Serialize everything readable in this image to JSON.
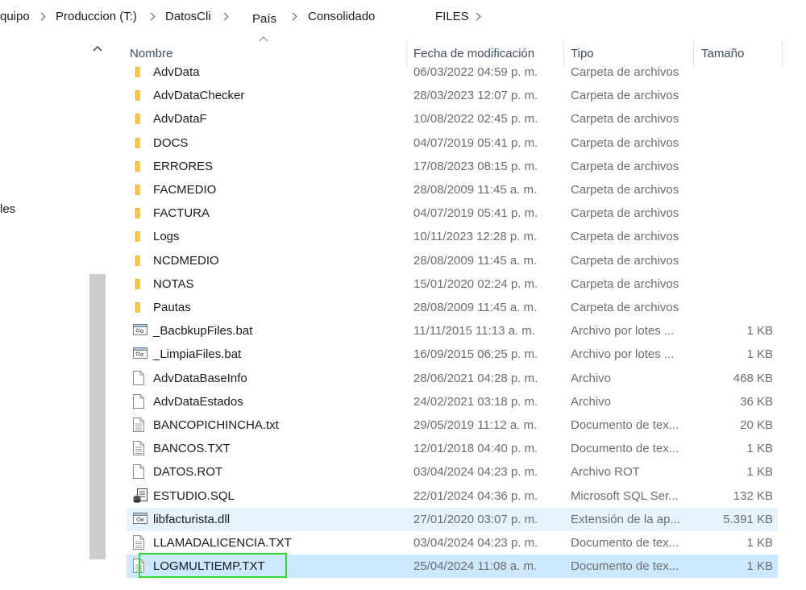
{
  "breadcrumb": [
    {
      "label": "quipo"
    },
    {
      "label": "Produccion (T:)"
    },
    {
      "label": "DatosCli"
    },
    {
      "label": "País"
    },
    {
      "label": "Consolidado"
    },
    {
      "label": "FILES"
    }
  ],
  "nav_fragment": "les",
  "columns": {
    "name": "Nombre",
    "date": "Fecha de modificación",
    "type": "Tipo",
    "size": "Tamaño"
  },
  "files": [
    {
      "name": "AdvData",
      "date": "06/03/2022 04:59 p. m.",
      "type": "Carpeta de archivos",
      "size": "",
      "icon": "folder-icon"
    },
    {
      "name": "AdvDataChecker",
      "date": "28/03/2023 12:07 p. m.",
      "type": "Carpeta de archivos",
      "size": "",
      "icon": "folder-icon"
    },
    {
      "name": "AdvDataF",
      "date": "10/08/2022 02:45 p. m.",
      "type": "Carpeta de archivos",
      "size": "",
      "icon": "folder-icon"
    },
    {
      "name": "DOCS",
      "date": "04/07/2019 05:41 p. m.",
      "type": "Carpeta de archivos",
      "size": "",
      "icon": "folder-icon"
    },
    {
      "name": "ERRORES",
      "date": "17/08/2023 08:15 p. m.",
      "type": "Carpeta de archivos",
      "size": "",
      "icon": "folder-icon"
    },
    {
      "name": "FACMEDIO",
      "date": "28/08/2009 11:45 a. m.",
      "type": "Carpeta de archivos",
      "size": "",
      "icon": "folder-icon"
    },
    {
      "name": "FACTURA",
      "date": "04/07/2019 05:41 p. m.",
      "type": "Carpeta de archivos",
      "size": "",
      "icon": "folder-icon"
    },
    {
      "name": "Logs",
      "date": "10/11/2023 12:28 p. m.",
      "type": "Carpeta de archivos",
      "size": "",
      "icon": "folder-icon"
    },
    {
      "name": "NCDMEDIO",
      "date": "28/08/2009 11:45 a. m.",
      "type": "Carpeta de archivos",
      "size": "",
      "icon": "folder-icon"
    },
    {
      "name": "NOTAS",
      "date": "15/01/2020 02:24 p. m.",
      "type": "Carpeta de archivos",
      "size": "",
      "icon": "folder-icon"
    },
    {
      "name": "Pautas",
      "date": "28/08/2009 11:45 a. m.",
      "type": "Carpeta de archivos",
      "size": "",
      "icon": "folder-icon"
    },
    {
      "name": "_BacbkupFiles.bat",
      "date": "11/11/2015 11:13 a. m.",
      "type": "Archivo por lotes ...",
      "size": "1 KB",
      "icon": "batch-file-icon"
    },
    {
      "name": "_LimpiaFiles.bat",
      "date": "16/09/2015 06:25 p. m.",
      "type": "Archivo por lotes ...",
      "size": "1 KB",
      "icon": "batch-file-icon"
    },
    {
      "name": "AdvDataBaseInfo",
      "date": "28/06/2021 04:28 p. m.",
      "type": "Archivo",
      "size": "468 KB",
      "icon": "blank-file-icon"
    },
    {
      "name": "AdvDataEstados",
      "date": "24/02/2021 03:18 p. m.",
      "type": "Archivo",
      "size": "36 KB",
      "icon": "blank-file-icon"
    },
    {
      "name": "BANCOPICHINCHA.txt",
      "date": "29/05/2019 11:12 a. m.",
      "type": "Documento de tex...",
      "size": "20 KB",
      "icon": "text-file-icon"
    },
    {
      "name": "BANCOS.TXT",
      "date": "12/01/2018 04:40 p. m.",
      "type": "Documento de tex...",
      "size": "1 KB",
      "icon": "text-file-icon"
    },
    {
      "name": "DATOS.ROT",
      "date": "03/04/2024 04:23 p. m.",
      "type": "Archivo ROT",
      "size": "1 KB",
      "icon": "blank-file-icon"
    },
    {
      "name": "ESTUDIO.SQL",
      "date": "22/01/2024 04:36 p. m.",
      "type": "Microsoft SQL Ser...",
      "size": "132 KB",
      "icon": "sql-file-icon"
    },
    {
      "name": "libfacturista.dll",
      "date": "27/01/2020 03:07 p. m.",
      "type": "Extensión de la ap...",
      "size": "5.391 KB",
      "icon": "dll-file-icon",
      "highlight": "hover"
    },
    {
      "name": "LLAMADALICENCIA.TXT",
      "date": "03/04/2024 04:23 p. m.",
      "type": "Documento de tex...",
      "size": "1 KB",
      "icon": "text-file-icon"
    },
    {
      "name": "LOGMULTIEMP.TXT",
      "date": "25/04/2024 11:08 a. m.",
      "type": "Documento de tex...",
      "size": "1 KB",
      "icon": "text-file-icon",
      "highlight": "selected"
    }
  ],
  "colors": {
    "hover_row": "#e5f3ff",
    "selected_row": "#cce8ff",
    "annotation_box": "#2ed82e",
    "folder": "#f4c449"
  }
}
